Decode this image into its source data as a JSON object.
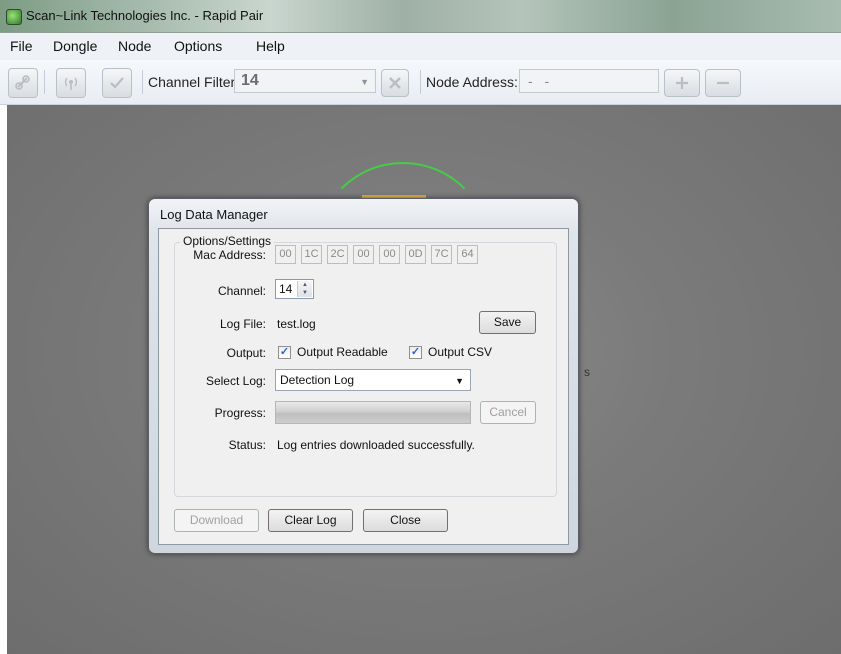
{
  "window": {
    "title": "Scan~Link Technologies Inc. - Rapid Pair",
    "icon": "app-icon"
  },
  "menu": [
    "File",
    "Dongle",
    "Node",
    "Options",
    "Help"
  ],
  "toolbar": {
    "channel_filter_label": "Channel Filter",
    "channel_filter_value": "14",
    "node_address_label": "Node Address:",
    "node_address_value": "- -",
    "icons": [
      "link-icon",
      "antenna-icon",
      "check-icon",
      "clear-icon",
      "plus-icon",
      "minus-icon"
    ]
  },
  "workspace": {
    "stray_text": "s"
  },
  "dialog": {
    "title": "Log Data Manager",
    "group_title": "Options/Settings",
    "labels": {
      "mac": "Mac Address:",
      "channel": "Channel:",
      "log_file": "Log File:",
      "output": "Output:",
      "select_log": "Select Log:",
      "progress": "Progress:",
      "status": "Status:"
    },
    "mac_octets": [
      "00",
      "1C",
      "2C",
      "00",
      "00",
      "0D",
      "7C",
      "64"
    ],
    "channel_value": "14",
    "log_file_value": "test.log",
    "save_label": "Save",
    "output_readable_label": "Output Readable",
    "output_readable_checked": true,
    "output_csv_label": "Output CSV",
    "output_csv_checked": true,
    "select_log_value": "Detection Log",
    "progress_fraction": 1.0,
    "cancel_label": "Cancel",
    "status_value": "Log entries downloaded successfully.",
    "download_label": "Download",
    "clear_log_label": "Clear Log",
    "close_label": "Close"
  }
}
